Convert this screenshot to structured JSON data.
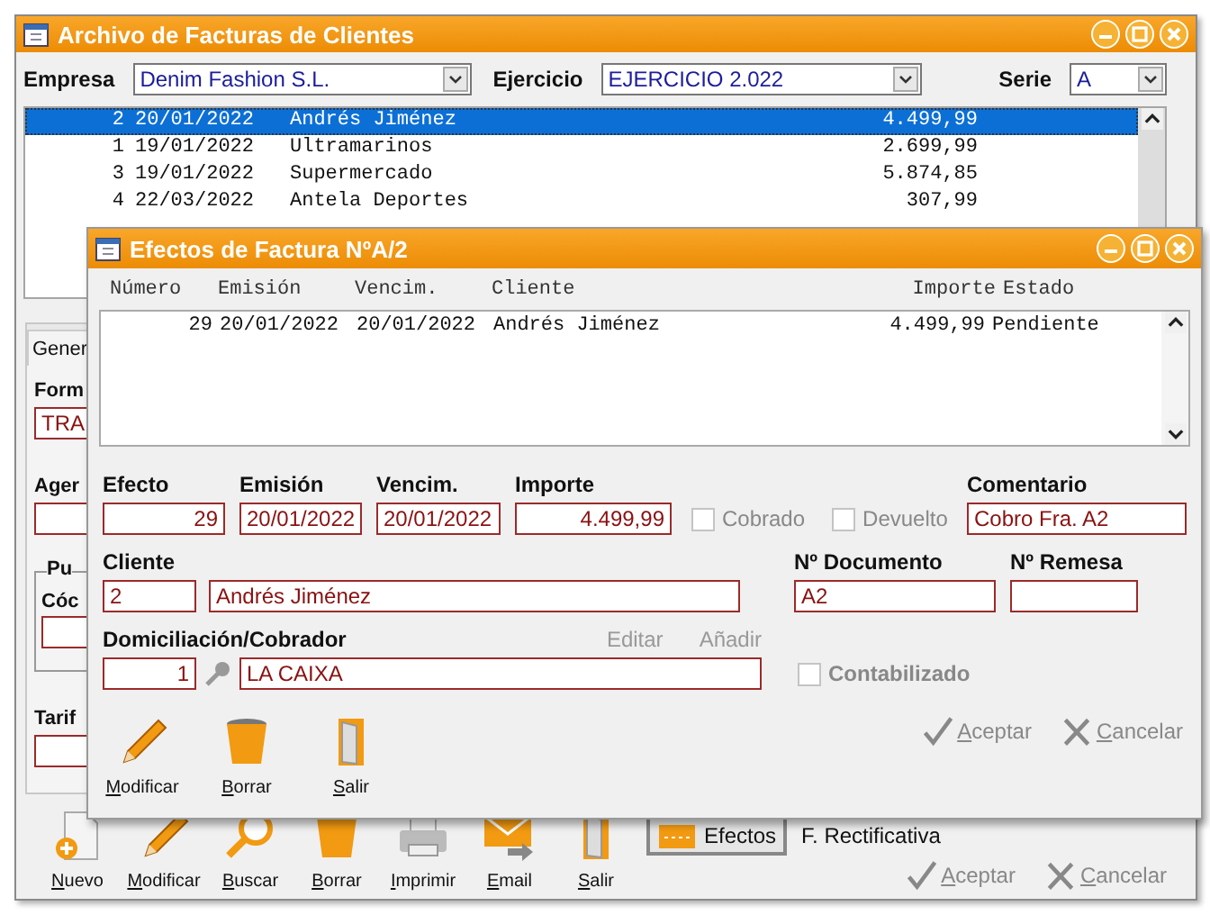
{
  "main_window": {
    "title": "Archivo de Facturas de Clientes",
    "filters": [
      {
        "label": "Empresa",
        "value": "Denim Fashion S.L."
      },
      {
        "label": "Ejercicio",
        "value": "EJERCICIO 2.022"
      },
      {
        "label": "Serie",
        "value": "A"
      }
    ],
    "invoices": [
      {
        "number": "2",
        "date": "20/01/2022",
        "client": "Andrés Jiménez",
        "amount": "4.499,99",
        "selected": true
      },
      {
        "number": "1",
        "date": "19/01/2022",
        "client": "Ultramarinos",
        "amount": "2.699,99",
        "selected": false
      },
      {
        "number": "3",
        "date": "19/01/2022",
        "client": "Supermercado",
        "amount": "5.874,85",
        "selected": false
      },
      {
        "number": "4",
        "date": "22/03/2022",
        "client": "Antela Deportes",
        "amount": "307,99",
        "selected": false
      }
    ],
    "tab": {
      "label": "Gener",
      "selected": true
    },
    "fields": [
      {
        "kind": "field",
        "label": "Form",
        "value": "TRA"
      },
      {
        "kind": "field",
        "label": "Ager"
      },
      {
        "kind": "group",
        "label": "Pu",
        "field_label": "Cóc"
      },
      {
        "kind": "field",
        "label": "Tarif"
      }
    ],
    "toolbar": [
      {
        "label": "Nuevo",
        "kind": "new"
      },
      {
        "label": "Modificar",
        "kind": "pencil"
      },
      {
        "label": "Buscar",
        "kind": "search"
      },
      {
        "label": "Borrar",
        "kind": "bin"
      },
      {
        "label": "Imprimir",
        "kind": "printer"
      },
      {
        "label": "Email",
        "kind": "mail"
      },
      {
        "label": "Salir",
        "kind": "door"
      }
    ],
    "efectos_button": "Efectos",
    "rectificativa": "F. Rectificativa",
    "actions": [
      {
        "label": "Aceptar",
        "kind": "accept",
        "disabled": true
      },
      {
        "label": "Cancelar",
        "kind": "cancel",
        "disabled": true
      }
    ]
  },
  "dialog": {
    "title": "Efectos de Factura NºA/2",
    "columns": [
      "Número",
      "Emisión",
      "Vencim.",
      "Cliente",
      "Importe",
      "Estado"
    ],
    "rows": [
      {
        "numero": "29",
        "emision": "20/01/2022",
        "vencim": "20/01/2022",
        "cliente": "Andrés Jiménez",
        "importe": "4.499,99",
        "estado": "Pendiente"
      }
    ],
    "efecto": {
      "label": "Efecto",
      "value": "29"
    },
    "emision": {
      "label": "Emisión",
      "value": "20/01/2022"
    },
    "vencim": {
      "label": "Vencim.",
      "value": "20/01/2022"
    },
    "importe": {
      "label": "Importe",
      "value": "4.499,99"
    },
    "cobrado": {
      "label": "Cobrado",
      "checked": false
    },
    "devuelto": {
      "label": "Devuelto",
      "checked": false
    },
    "comentario": {
      "label": "Comentario",
      "value": "Cobro Fra. A2"
    },
    "cliente": {
      "label": "Cliente",
      "code": "2",
      "name": "Andrés Jiménez"
    },
    "documento": {
      "label": "Nº Documento",
      "value": "A2"
    },
    "remesa": {
      "label": "Nº Remesa"
    },
    "domiciliacion": {
      "label": "Domiciliación/Cobrador",
      "code": "1",
      "name": "LA CAIXA",
      "links": [
        {
          "label": "Editar",
          "disabled": true
        },
        {
          "label": "Añadir",
          "disabled": true
        }
      ]
    },
    "contabilizado": {
      "label": "Contabilizado",
      "checked": false
    },
    "tools": [
      {
        "label": "Modificar",
        "kind": "pencil"
      },
      {
        "label": "Borrar",
        "kind": "bin"
      },
      {
        "label": "Salir",
        "kind": "door"
      }
    ],
    "actions": [
      {
        "label": "Aceptar",
        "kind": "accept",
        "disabled": true
      },
      {
        "label": "Cancelar",
        "kind": "cancel",
        "disabled": true
      }
    ]
  }
}
